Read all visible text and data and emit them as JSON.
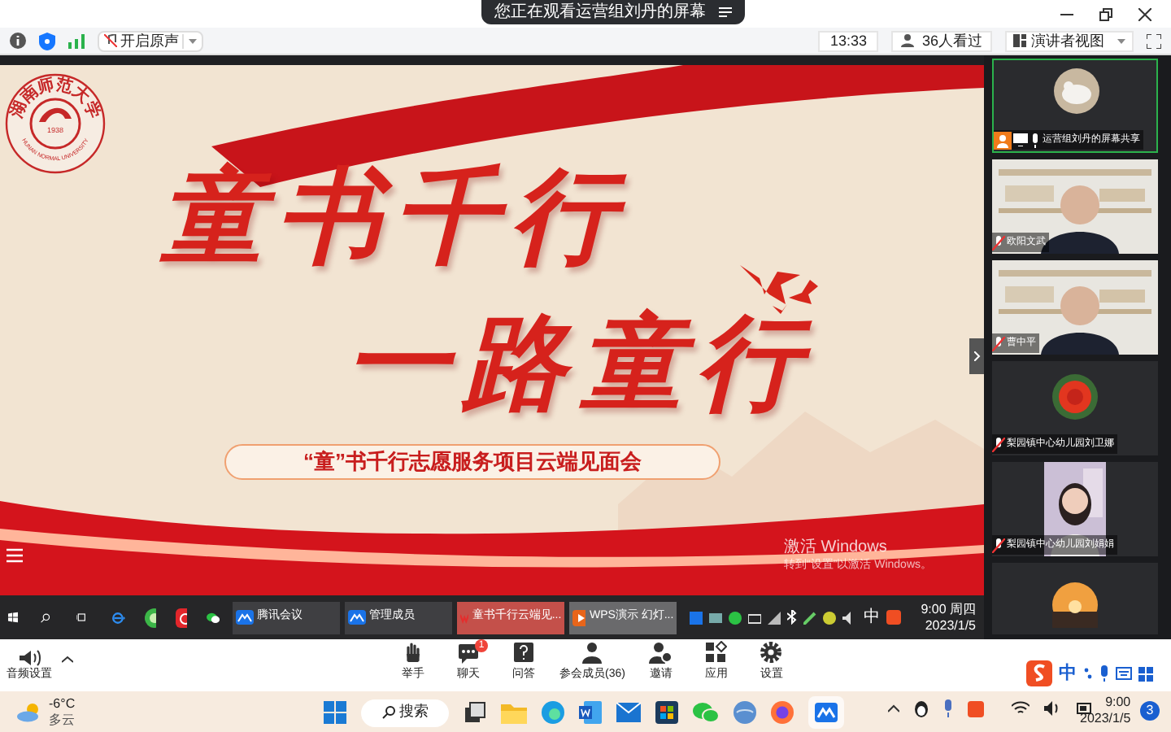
{
  "notice": {
    "text": "您正在观看运营组刘丹的屏幕"
  },
  "toolbar": {
    "audio_button": "开启原声",
    "time": "13:33",
    "viewers": "36人看过",
    "view_button": "演讲者视图"
  },
  "slide": {
    "logo": {
      "name": "湖南师范大学",
      "english": "HUNAN NORMAL UNIVERSITY",
      "year": "1938"
    },
    "title_lines": [
      "童书千行",
      "一路童行"
    ],
    "subtitle": "“童”书千行志愿服务项目云端见面会",
    "activation": [
      "激活 Windows",
      "转到“设置”以激活 Windows。"
    ]
  },
  "inner_taskbar": {
    "apps": [
      {
        "label": "腾讯会议",
        "kind": "meeting",
        "selected": false
      },
      {
        "label": "管理成员",
        "kind": "meeting",
        "selected": false
      },
      {
        "label": "童书千行云端见...",
        "kind": "wps",
        "selected": true
      },
      {
        "label": "WPS演示 幻灯...",
        "kind": "slides",
        "selected": false
      }
    ],
    "ime": "中",
    "time": "9:00 周四",
    "date": "2023/1/5"
  },
  "participants": [
    {
      "name": "运营组刘丹的屏幕共享",
      "kind": "avatar",
      "muted": false,
      "sharing": true
    },
    {
      "name": "欧阳文武",
      "kind": "video",
      "muted": true,
      "sharing": false
    },
    {
      "name": "曹中平",
      "kind": "video",
      "muted": true,
      "sharing": false
    },
    {
      "name": "梨园镇中心幼儿园刘卫娜",
      "kind": "avatar",
      "muted": true,
      "sharing": false
    },
    {
      "name": "梨园镇中心幼儿园刘娟娟",
      "kind": "portrait",
      "muted": true,
      "sharing": false
    },
    {
      "kind": "avatar"
    }
  ],
  "meeting_toolbar": {
    "audio": "音频设置",
    "buttons": [
      {
        "label": "举手",
        "kind": "hand"
      },
      {
        "label": "聊天",
        "kind": "chat",
        "badge": "1"
      },
      {
        "label": "问答",
        "kind": "qa"
      },
      {
        "label": "参会成员(36)",
        "kind": "members"
      },
      {
        "label": "邀请",
        "kind": "invite"
      },
      {
        "label": "应用",
        "kind": "apps"
      },
      {
        "label": "设置",
        "kind": "settings"
      }
    ]
  },
  "ime_bar": {
    "mode": "中"
  },
  "taskbar": {
    "weather": {
      "temp": "-6°C",
      "condition": "多云"
    },
    "search": "搜索",
    "time": "9:00",
    "date": "2023/1/5",
    "notifications": "3"
  }
}
